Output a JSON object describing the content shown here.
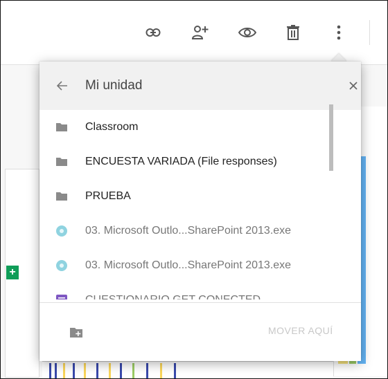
{
  "toolbar": {
    "icons": [
      "link-icon",
      "add-person-icon",
      "eye-icon",
      "trash-icon",
      "more-vert-icon"
    ]
  },
  "move_panel": {
    "title": "Mi unidad",
    "back_icon": "arrow-back-icon",
    "close_icon": "close-icon",
    "items": [
      {
        "type": "folder",
        "icon": "folder-icon",
        "label": "Classroom"
      },
      {
        "type": "folder",
        "icon": "folder-icon",
        "label": "ENCUESTA VARIADA (File responses)"
      },
      {
        "type": "folder",
        "icon": "folder-icon",
        "label": "PRUEBA"
      },
      {
        "type": "file",
        "icon": "exe-file-icon",
        "label": "03. Microsoft Outlo...SharePoint 2013.exe"
      },
      {
        "type": "file",
        "icon": "exe-file-icon",
        "label": "03. Microsoft Outlo...SharePoint 2013.exe"
      },
      {
        "type": "file",
        "icon": "forms-file-icon",
        "label": "CUESTIONARIO GET CONECTED"
      }
    ],
    "new_folder_icon": "new-folder-icon",
    "move_button": "MOVER AQUÍ"
  },
  "colors": {
    "header_bg": "#f1f1f1",
    "folder_icon": "#8a8a8a",
    "exe_icon": "#8fd3e0",
    "forms_icon": "#7e57c2",
    "disabled_text": "#c8c8c8",
    "sheets_green": "#0f9d58"
  }
}
